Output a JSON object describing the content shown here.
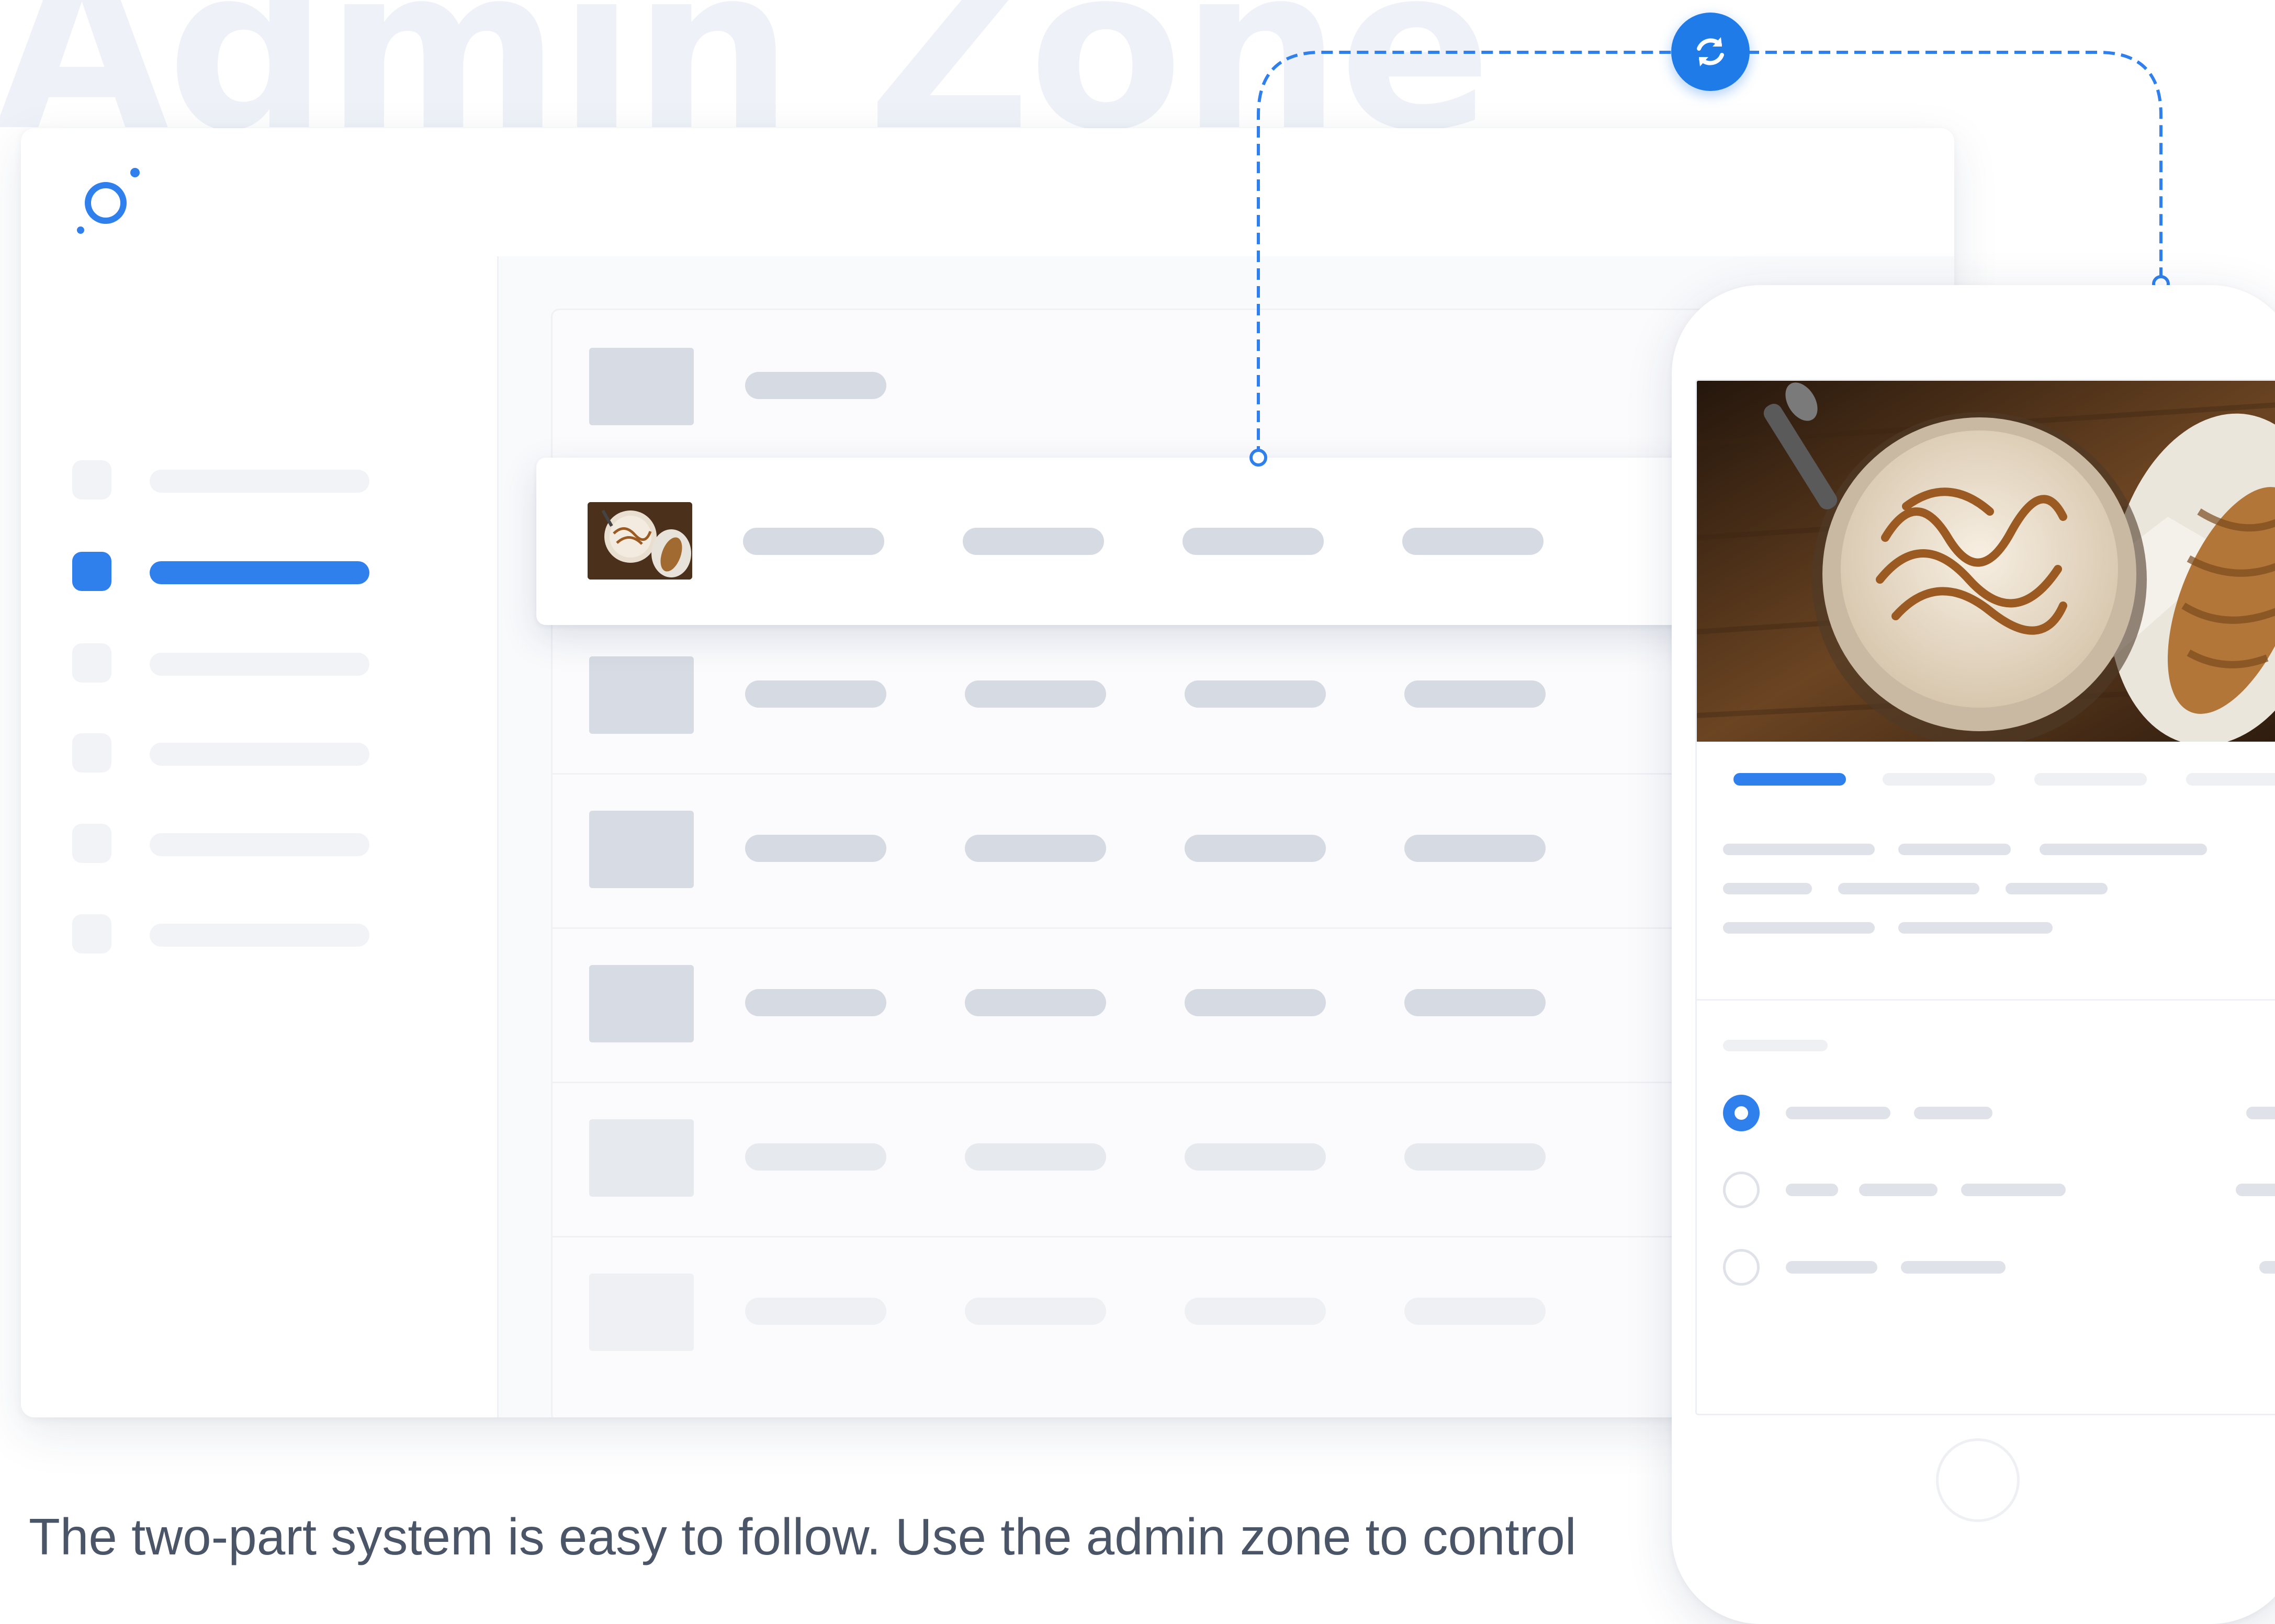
{
  "watermark": {
    "text": "Admin Zone"
  },
  "caption": {
    "text": "The two-part system is easy to follow. Use the admin zone to control"
  },
  "colors": {
    "accent": "#2f80ed",
    "placeholder": "#d6dae2",
    "text": "#4a5568",
    "watermark": "#eef2f8"
  },
  "icons": {
    "logo": "ring-logo-icon",
    "sync": "sync-arrows-icon",
    "food": "coffee-croissant-photo"
  },
  "sidebar": {
    "item_count": 6,
    "active_index": 1
  },
  "list": {
    "row_count": 7,
    "highlighted_row_index": 1
  },
  "phone": {
    "tabs_count": 4,
    "active_tab_index": 0,
    "options": {
      "count": 3,
      "selected_index": 0
    }
  }
}
